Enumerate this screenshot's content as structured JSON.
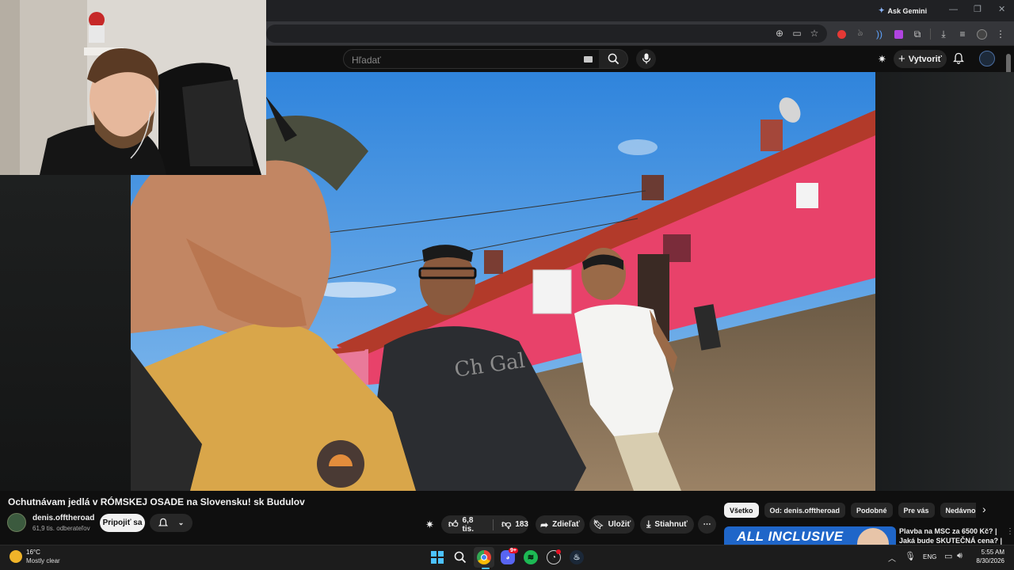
{
  "browser": {
    "ask_gemini": "Ask Gemini"
  },
  "youtube": {
    "search_placeholder": "Hľadať",
    "create_label": "Vytvoriť"
  },
  "video": {
    "title": "Ochutnávam jedlá v RÓMSKEJ OSADE na Slovensku! sk Budulov",
    "channel_name": "denis.offtheroad",
    "subscribers": "61,9 tis. odberateľov",
    "join_label": "Pripojiť sa",
    "likes": "6,8 tis.",
    "dislikes": "183",
    "share_label": "Zdieľať",
    "save_label": "Uložiť",
    "download_label": "Stiahnuť"
  },
  "chips": [
    "Všetko",
    "Od: denis.offtheroad",
    "Podobné",
    "Pre vás",
    "Nedávno nahran"
  ],
  "recommendation": {
    "thumb_text": "ALL INCLUSIVE",
    "title_line1": "Plavba na MSC za 6500 Kč? |",
    "title_line2": "Jaká bude SKUTEČNÁ cena? |"
  },
  "taskbar": {
    "temperature": "16°C",
    "weather": "Mostly clear",
    "language": "ENG",
    "time": "5:55 AM",
    "date": "8/30/2026",
    "discord_badge": "9+"
  },
  "colors": {
    "accent": "#3ea6ff",
    "youtube_bg": "#0f0f0f",
    "chrome_toolbar": "#35363a"
  }
}
